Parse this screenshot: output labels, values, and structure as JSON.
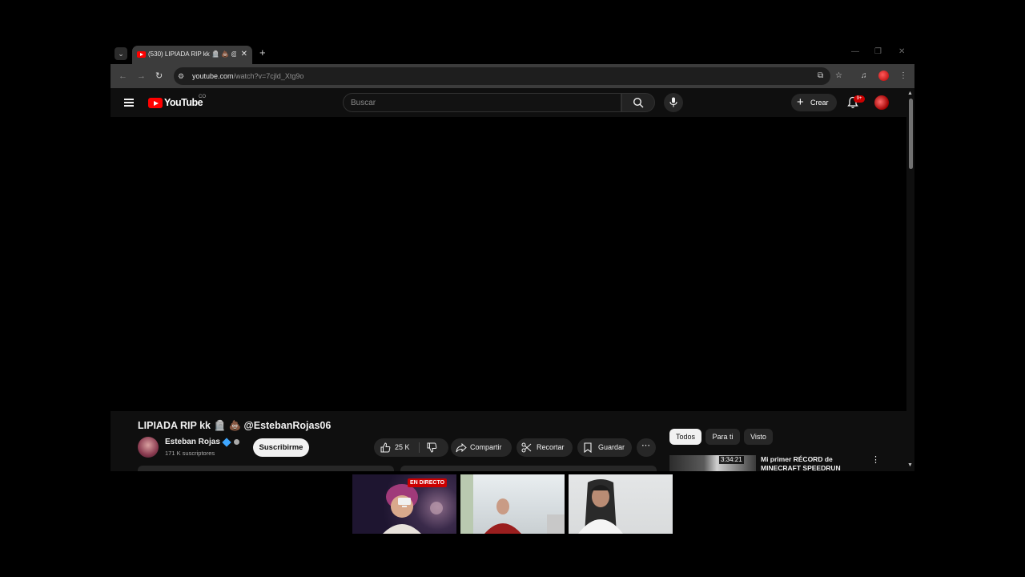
{
  "browser": {
    "tab_title": "(530) LIPIADA RIP kk 🪦 💩 @E",
    "url_host": "youtube.com",
    "url_path": "/watch?v=7cjld_Xtg9o"
  },
  "youtube": {
    "logo_text": "YouTube",
    "logo_country": "CO",
    "search_placeholder": "Buscar",
    "create_label": "Crear",
    "notifications_badge": "9+"
  },
  "video": {
    "title": "LIPIADA RIP kk 🪦 💩 @EstebanRojas06",
    "channel_name": "Esteban Rojas",
    "subscribers": "171 K suscriptores",
    "subscribe_label": "Suscribirme",
    "likes": "25 K",
    "share_label": "Compartir",
    "clip_label": "Recortar",
    "save_label": "Guardar"
  },
  "filter_chips": [
    "Todos",
    "Para ti",
    "Visto"
  ],
  "related": [
    {
      "duration": "3:34:21",
      "title": "Mi primer RÉCORD de MINECRAFT SPEEDRUN"
    }
  ],
  "meeting": {
    "live_badge": "EN DIRECTO"
  },
  "colors": {
    "youtube_red": "#ff0000",
    "page_bg": "#0f0f0f",
    "pill_bg": "#272727",
    "live_red": "#cc0000"
  }
}
